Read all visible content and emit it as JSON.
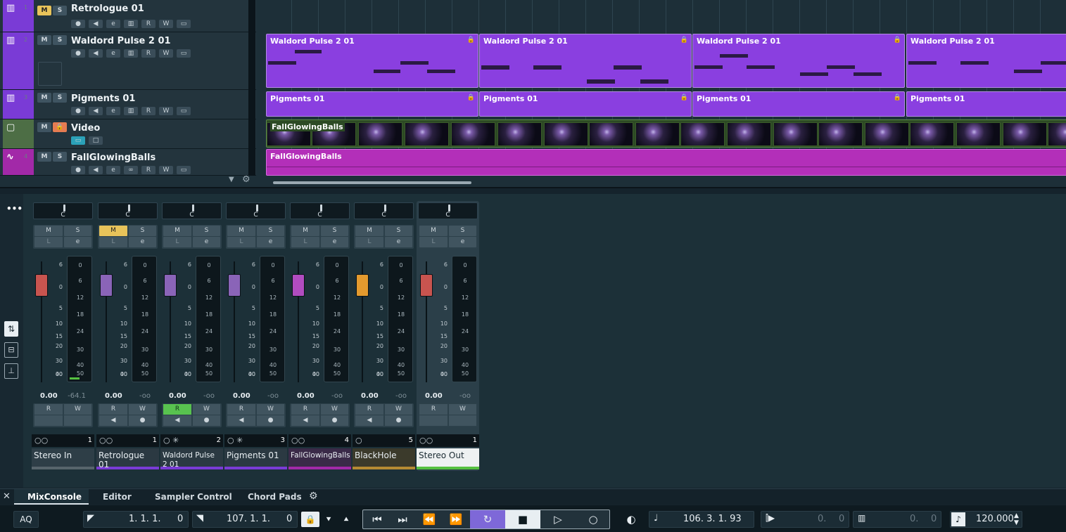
{
  "tracks": [
    {
      "num": "1",
      "name": "Retrologue 01",
      "color": "#7a3bd6",
      "m": "M",
      "s": "S",
      "m_on": true
    },
    {
      "num": "2",
      "name": "Waldord Pulse 2 01",
      "color": "#7a3bd6",
      "m": "M",
      "s": "S"
    },
    {
      "num": "3",
      "name": "Pigments 01",
      "color": "#7a3bd6",
      "m": "M",
      "s": "S"
    },
    {
      "num": "",
      "name": "Video",
      "color": "#4d6e45",
      "m": "M",
      "s": "S"
    },
    {
      "num": "4",
      "name": "FallGlowingBalls",
      "color": "#a229a8",
      "m": "M",
      "s": "S"
    }
  ],
  "track_ctrl": {
    "e": "e",
    "r": "R",
    "w": "W"
  },
  "parts": {
    "waldord": "Waldord Pulse 2 01",
    "pigments": "Pigments 01",
    "video": "FallGlowingBalls",
    "audio": "FallGlowingBalls",
    "lock_icon": "lock-icon"
  },
  "mixer": {
    "pan_label": "C",
    "m": "M",
    "s": "S",
    "l": "L",
    "e": "e",
    "r": "R",
    "w": "W",
    "scale": [
      "6",
      "0",
      "5",
      "10",
      "15",
      "20",
      "30",
      "40",
      "00"
    ],
    "meter_scale": [
      "0",
      "6",
      "12",
      "18",
      "24",
      "30",
      "40",
      "50"
    ],
    "channels": [
      {
        "label": "Stereo In",
        "volume": "0.00",
        "peak": "-64.1",
        "route": "1",
        "fader_color": "#c8544f",
        "label_bg": "#2e3e47",
        "bar": "#57646b",
        "m_on": false,
        "r_on": false
      },
      {
        "label": "Retrologue 01",
        "volume": "0.00",
        "peak": "-oo",
        "route": "1",
        "fader_color": "#8a64b8",
        "label_bg": "#2b3942",
        "bar": "#7a3bd6",
        "m_on": true,
        "r_on": false
      },
      {
        "label": "Waldord Pulse 2 01",
        "volume": "0.00",
        "peak": "-oo",
        "route": "2",
        "fader_color": "#8a64b8",
        "label_bg": "#2b3942",
        "bar": "#7a3bd6",
        "m_on": false,
        "r_on": true
      },
      {
        "label": "Pigments 01",
        "volume": "0.00",
        "peak": "-oo",
        "route": "3",
        "fader_color": "#8a64b8",
        "label_bg": "#2b3942",
        "bar": "#7a3bd6",
        "m_on": false,
        "r_on": false
      },
      {
        "label": "FallGlowingBalls",
        "volume": "0.00",
        "peak": "-oo",
        "route": "4",
        "fader_color": "#b14cc0",
        "label_bg": "#3a2a48",
        "bar": "#a229a8",
        "m_on": false,
        "r_on": false
      },
      {
        "label": "BlackHole",
        "volume": "0.00",
        "peak": "-oo",
        "route": "5",
        "fader_color": "#e49a2e",
        "label_bg": "#3b3a2b",
        "bar": "#b58a33",
        "m_on": false,
        "r_on": false
      },
      {
        "label": "Stereo Out",
        "volume": "0.00",
        "peak": "-oo",
        "route": "1",
        "fader_color": "#c8544f",
        "label_bg": "#eef1f2",
        "bar": "#55c040",
        "m_on": false,
        "r_on": false
      }
    ]
  },
  "tabs": [
    "MixConsole",
    "Editor",
    "Sampler Control",
    "Chord Pads"
  ],
  "transport": {
    "aq": "AQ",
    "left_locator": "1. 1. 1.",
    "left_locator_ticks": "0",
    "right_locator": "107. 1. 1.",
    "right_locator_ticks": "0",
    "position": "106. 3. 1. 93",
    "punch_a": "0.",
    "punch_a2": "0",
    "punch_b": "0.",
    "punch_b2": "0",
    "tempo": "120.000"
  }
}
